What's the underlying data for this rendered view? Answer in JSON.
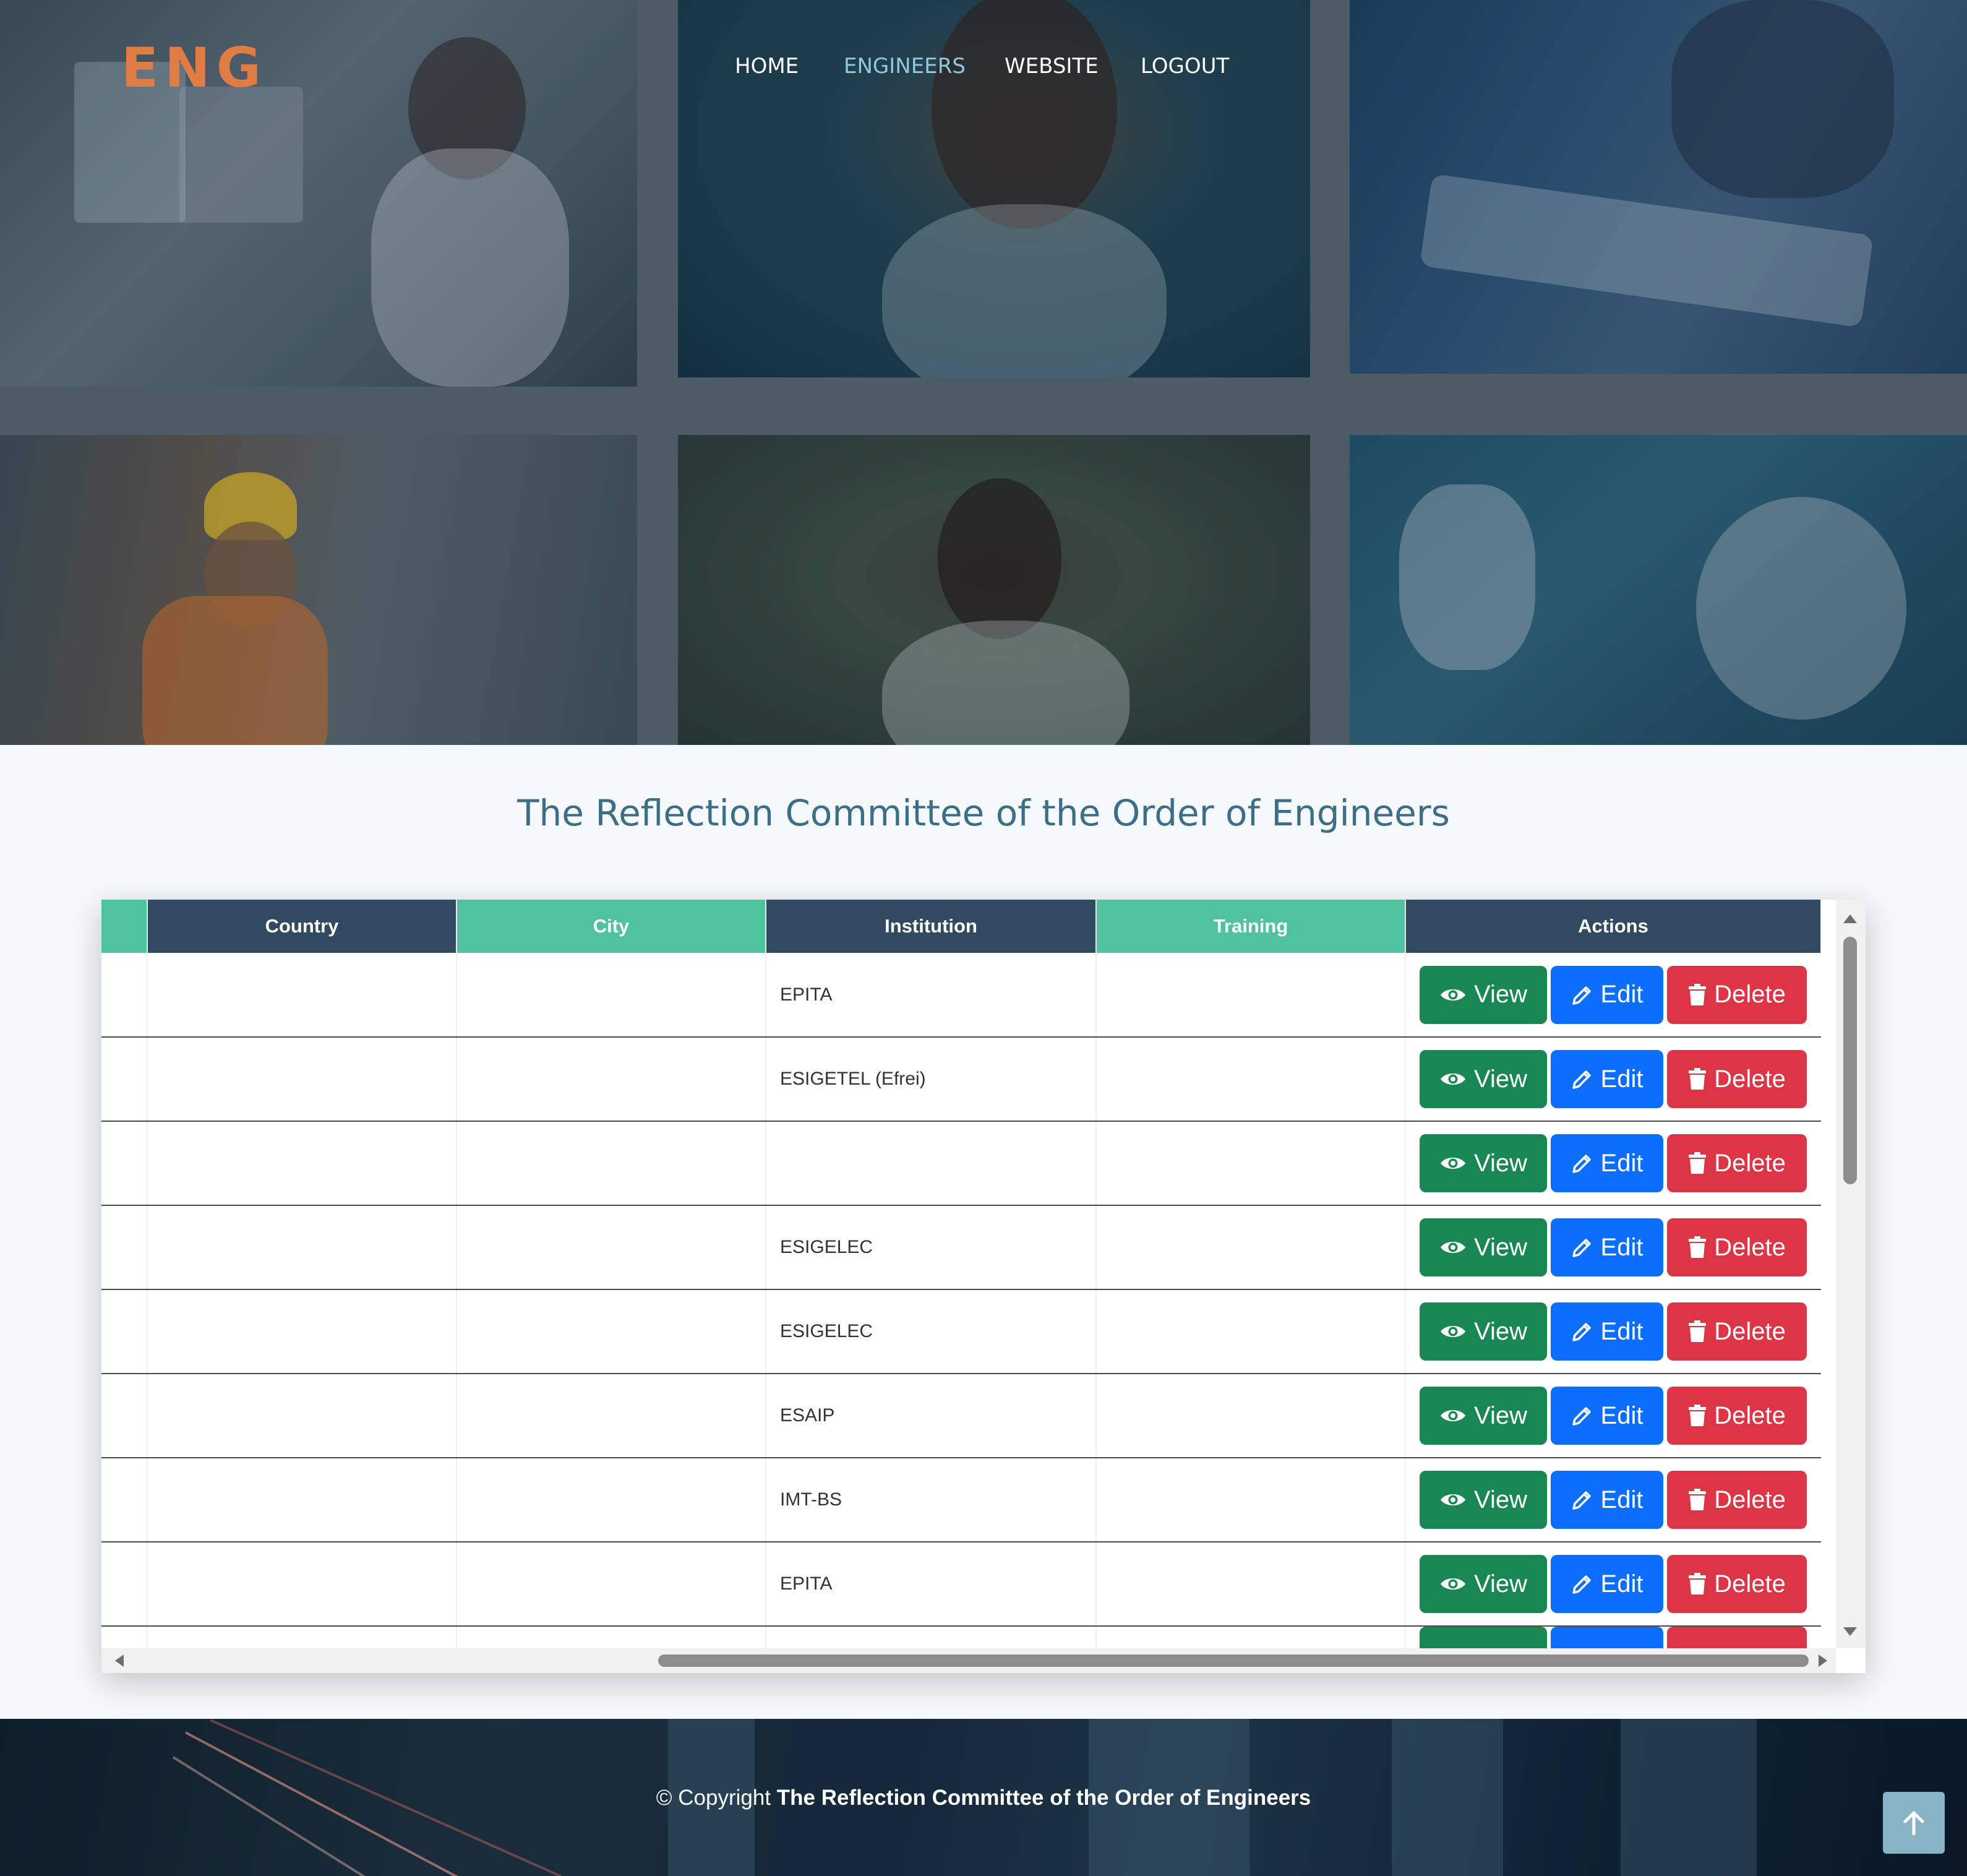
{
  "brand": {
    "logo": "ENG"
  },
  "nav": {
    "items": [
      {
        "label": "HOME"
      },
      {
        "label": "ENGINEERS"
      },
      {
        "label": "WEBSITE"
      },
      {
        "label": "LOGOUT"
      }
    ]
  },
  "page": {
    "title": "The Reflection Committee of the Order of Engineers"
  },
  "table": {
    "columns": [
      "",
      "Country",
      "City",
      "Institution",
      "Training",
      "Actions"
    ],
    "action_labels": {
      "view": "View",
      "edit": "Edit",
      "delete": "Delete"
    },
    "rows": [
      {
        "institution": "EPITA"
      },
      {
        "institution": "ESIGETEL (Efrei)"
      },
      {
        "institution": ""
      },
      {
        "institution": "ESIGELEC"
      },
      {
        "institution": "ESIGELEC"
      },
      {
        "institution": "ESAIP"
      },
      {
        "institution": "IMT-BS"
      },
      {
        "institution": "EPITA"
      }
    ]
  },
  "footer": {
    "prefix": "© Copyright",
    "org": "The Reflection Committee of the Order of Engineers"
  },
  "colors": {
    "brand": "#e07d44",
    "nav_active": "#8fc9dd",
    "title": "#3d6e88",
    "header_dark": "#324962",
    "header_green": "#50c29d",
    "view": "#198754",
    "edit": "#0d6efd",
    "delete": "#dc3545",
    "back_to_top": "#86b4c5"
  },
  "icons": {
    "view": "eye-icon",
    "edit": "pencil-icon",
    "delete": "trash-icon",
    "back_to_top": "arrow-up-icon"
  }
}
